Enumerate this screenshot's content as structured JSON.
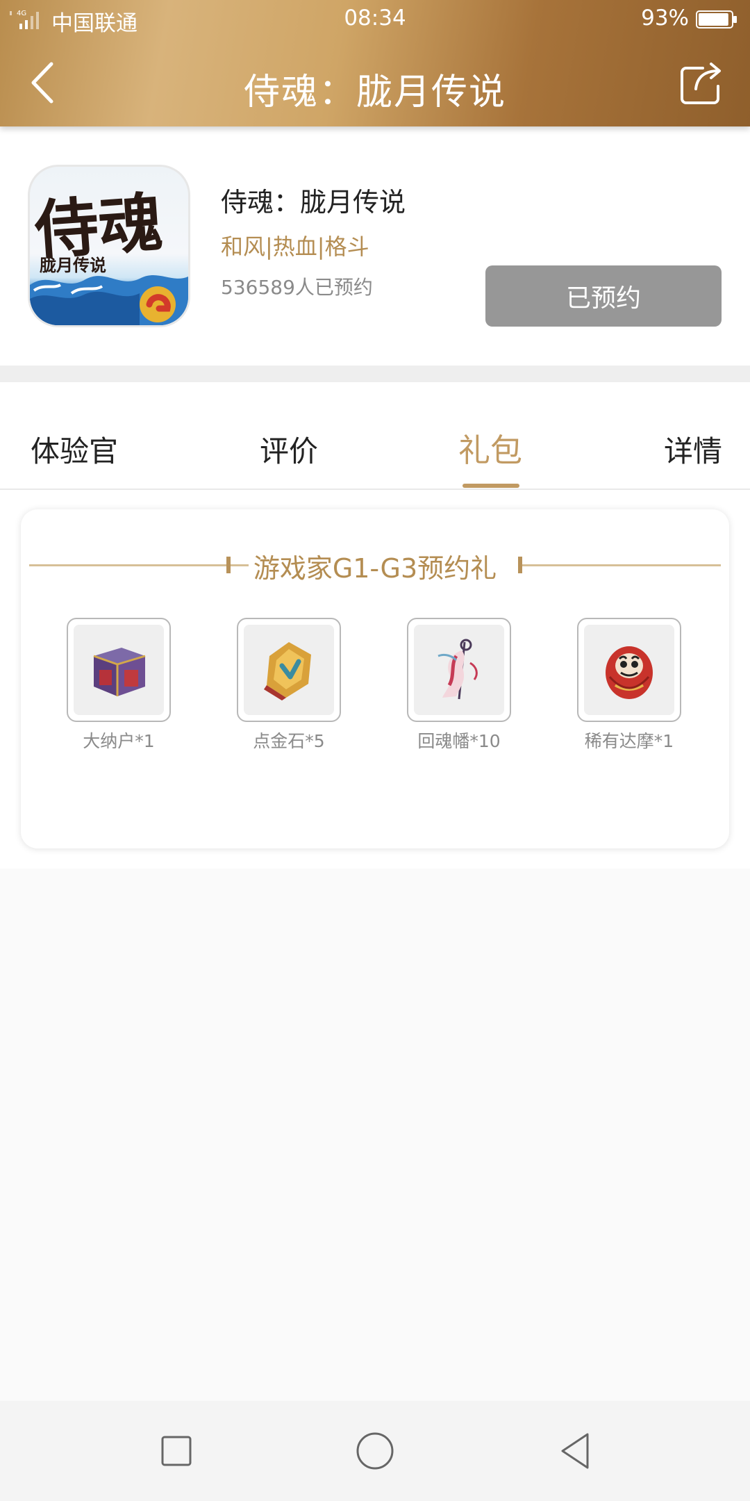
{
  "status_bar": {
    "network": "4G",
    "carrier": "中国联通",
    "time": "08:34",
    "battery": "93%",
    "battery_level": 0.93
  },
  "header": {
    "title": "侍魂：胧月传说"
  },
  "app": {
    "name": "侍魂：胧月传说",
    "tags": "和风|热血|格斗",
    "reservations": "536589人已预约",
    "reserve_button": "已预约",
    "icon_calligraphy": "侍魂",
    "icon_subtitle": "胧月传说"
  },
  "tabs": [
    {
      "label": "体验官"
    },
    {
      "label": "评价"
    },
    {
      "label": "礼包",
      "active": true
    },
    {
      "label": "详情"
    }
  ],
  "gift": {
    "title": "游戏家G1-G3预约礼",
    "items": [
      {
        "label": "大纳户*1",
        "icon": "chest-icon"
      },
      {
        "label": "点金石*5",
        "icon": "gold-stone-icon"
      },
      {
        "label": "回魂幡*10",
        "icon": "soul-banner-icon"
      },
      {
        "label": "稀有达摩*1",
        "icon": "daruma-icon"
      }
    ]
  },
  "colors": {
    "accent": "#c19a62",
    "header_gold": "#cfa566",
    "reserved_button": "#979797"
  }
}
